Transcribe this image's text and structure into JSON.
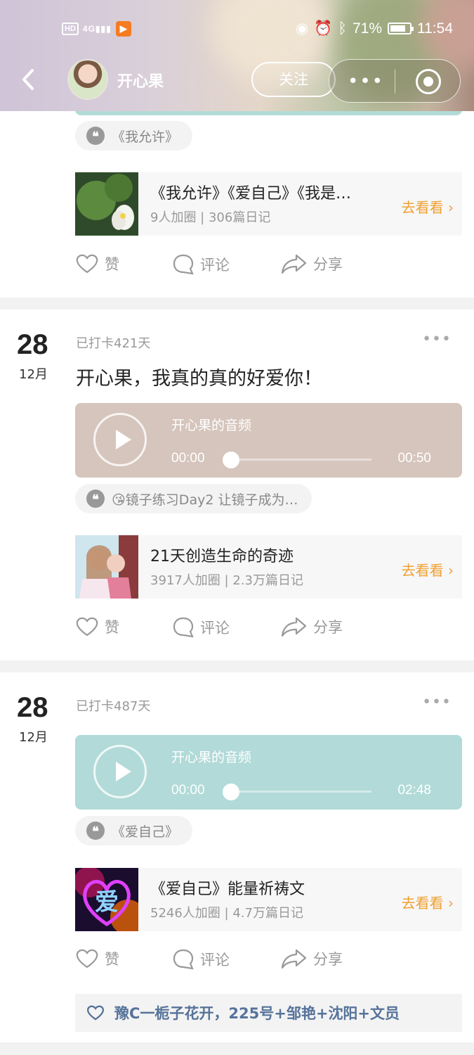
{
  "status_bar": {
    "hd": "HD",
    "signal": "4G",
    "battery": "71%",
    "time": "11:54"
  },
  "nav": {
    "nickname": "开心果",
    "follow_label": "关注",
    "more_dots": "•••"
  },
  "posts": [
    {
      "quote": "《我允许》",
      "circle": {
        "title": "《我允许》《爱自己》《我是…",
        "meta": "9人加圈 | 306篇日记",
        "go": "去看看"
      },
      "actions": {
        "like": "赞",
        "comment": "评论",
        "share": "分享"
      }
    },
    {
      "day": "28",
      "month": "12月",
      "checkin": "已打卡421天",
      "text": "开心果，我真的真的好爱你！",
      "audio": {
        "title": "开心果的音频",
        "start": "00:00",
        "end": "00:50",
        "color": "#d5c5bc"
      },
      "quote": "😘镜子练习Day2 让镜子成为…",
      "circle": {
        "title": "21天创造生命的奇迹",
        "meta": "3917人加圈 | 2.3万篇日记",
        "go": "去看看"
      },
      "actions": {
        "like": "赞",
        "comment": "评论",
        "share": "分享"
      }
    },
    {
      "day": "28",
      "month": "12月",
      "checkin": "已打卡487天",
      "audio": {
        "title": "开心果的音频",
        "start": "00:00",
        "end": "02:48",
        "color": "#b1dad8"
      },
      "quote": "《爱自己》",
      "circle": {
        "title": "《爱自己》能量祈祷文",
        "meta": "5246人加圈 | 4.7万篇日记",
        "go": "去看看",
        "thumb_text": "爱"
      },
      "actions": {
        "like": "赞",
        "comment": "评论",
        "share": "分享"
      },
      "liked_by": "豫C一栀子花开，225号+邹艳+沈阳+文员"
    }
  ],
  "colors": {
    "accent_orange": "#f0a030",
    "liker_blue": "#56739a"
  }
}
